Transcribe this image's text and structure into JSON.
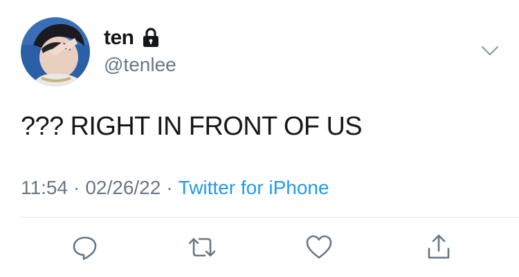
{
  "user": {
    "display_name": "ten",
    "handle": "@tenlee",
    "locked_icon": "lock-icon",
    "avatar_icon": "profile-photo"
  },
  "tweet": {
    "text": "??? RIGHT IN FRONT OF US",
    "time": "11:54",
    "date": "02/26/22",
    "separator": "·",
    "source": "Twitter for iPhone"
  },
  "menu": {
    "icon": "chevron-down-icon"
  },
  "actions": [
    {
      "name": "reply",
      "icon": "reply-icon"
    },
    {
      "name": "retweet",
      "icon": "retweet-icon"
    },
    {
      "name": "like",
      "icon": "heart-icon"
    },
    {
      "name": "share",
      "icon": "share-icon"
    }
  ],
  "colors": {
    "primary_text": "#14171a",
    "secondary_text": "#657786",
    "link": "#1d9bf0",
    "divider": "#e1e8ed"
  }
}
